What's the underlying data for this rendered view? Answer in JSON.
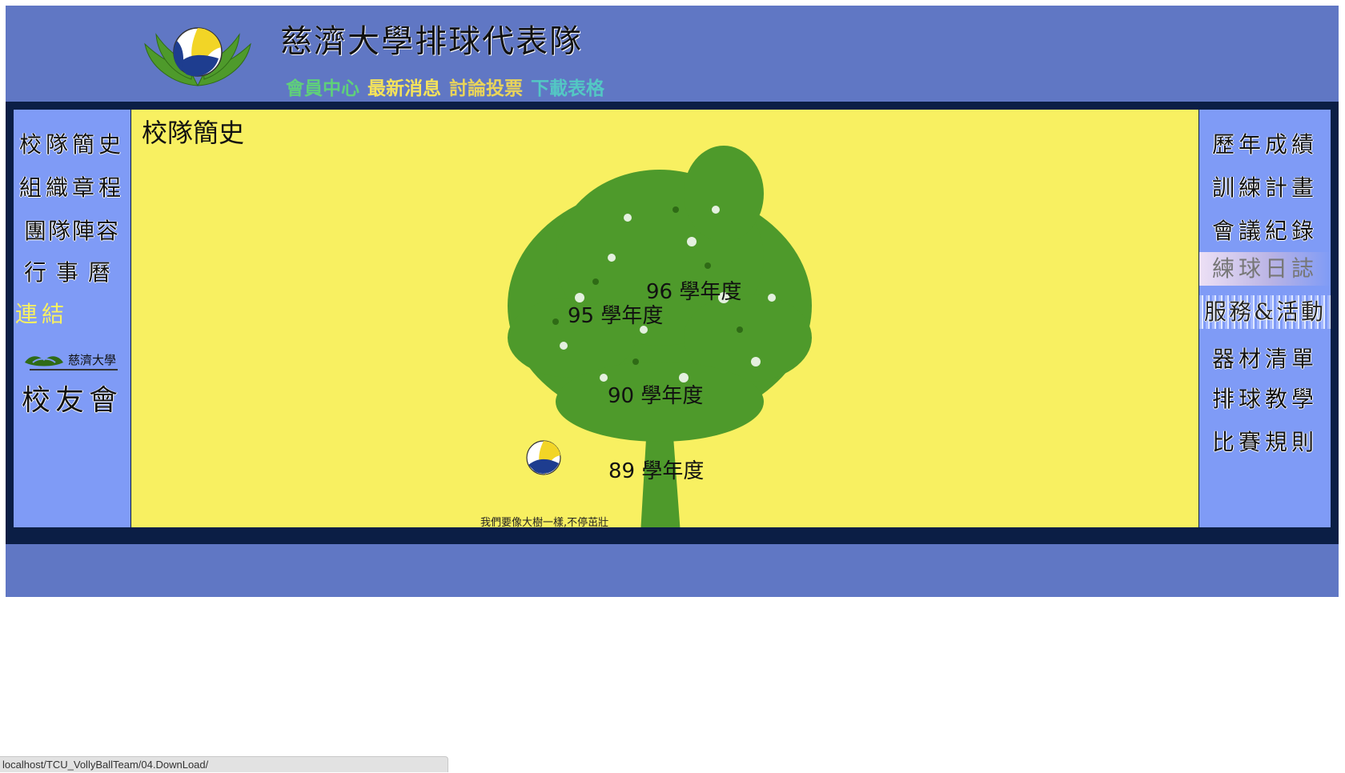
{
  "site": {
    "title": "慈濟大學排球代表隊"
  },
  "topnav": [
    {
      "label": "會員中心",
      "color": "#5fd07a"
    },
    {
      "label": "最新消息",
      "color": "#f5e35a"
    },
    {
      "label": "討論投票",
      "color": "#e9d45a"
    },
    {
      "label": "下載表格",
      "color": "#53c8c4"
    }
  ],
  "left_nav": {
    "items": [
      "校隊簡史",
      "組織章程",
      "團隊陣容",
      "行事曆"
    ],
    "link_heading": "連結",
    "alumni": "校友會"
  },
  "right_nav": {
    "items": [
      "歷年成績",
      "訓練計畫",
      "會議紀錄",
      "練球日誌",
      "服務&活動",
      "器材清單",
      "排球教學",
      "比賽規則"
    ]
  },
  "content": {
    "title": "校隊簡史",
    "years": [
      "96 學年度",
      "95 學年度",
      "90 學年度",
      "89 學年度"
    ],
    "caption": "我們要像大樹一樣,不停茁壯"
  },
  "colors": {
    "page_bg": "#6077c4",
    "frame": "#0b1e45",
    "nav_bg": "#7f9bf6",
    "content_bg": "#f8f061",
    "tree": "#4e9a2b"
  },
  "status_bar": {
    "url": "localhost/TCU_VollyBallTeam/04.DownLoad/"
  }
}
